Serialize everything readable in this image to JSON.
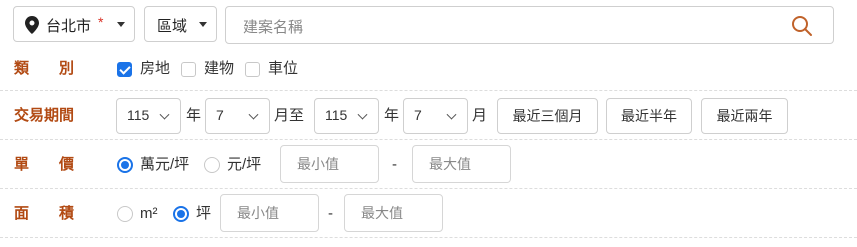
{
  "top": {
    "city": {
      "label": "台北市",
      "required_mark": "*"
    },
    "district": {
      "label": "區域"
    },
    "search": {
      "placeholder": "建案名稱"
    }
  },
  "rows": {
    "category": {
      "label": "類　　別",
      "options": [
        {
          "label": "房地",
          "checked": true
        },
        {
          "label": "建物",
          "checked": false
        },
        {
          "label": "車位",
          "checked": false
        }
      ]
    },
    "period": {
      "label": "交易期間",
      "from_year": "115",
      "from_month": "7",
      "to_year": "115",
      "to_month": "7",
      "year_unit": "年",
      "month_to": "月至",
      "month_unit": "月",
      "quick_buttons": [
        "最近三個月",
        "最近半年",
        "最近兩年"
      ]
    },
    "unit_price": {
      "label": "單　　價",
      "options": [
        {
          "label": "萬元/坪",
          "checked": true
        },
        {
          "label": "元/坪",
          "checked": false
        }
      ],
      "min_placeholder": "最小值",
      "dash": "-",
      "max_placeholder": "最大值"
    },
    "area": {
      "label": "面　　積",
      "options": [
        {
          "label": "m²",
          "checked": false
        },
        {
          "label": "坪",
          "checked": true
        }
      ],
      "min_placeholder": "最小值",
      "dash": "-",
      "max_placeholder": "最大值"
    }
  },
  "colors": {
    "label": "#b24a13",
    "accent": "#1a73e8",
    "border": "#cfcfcf"
  },
  "icons": {
    "location": "map-pin-icon",
    "search": "search-icon"
  }
}
